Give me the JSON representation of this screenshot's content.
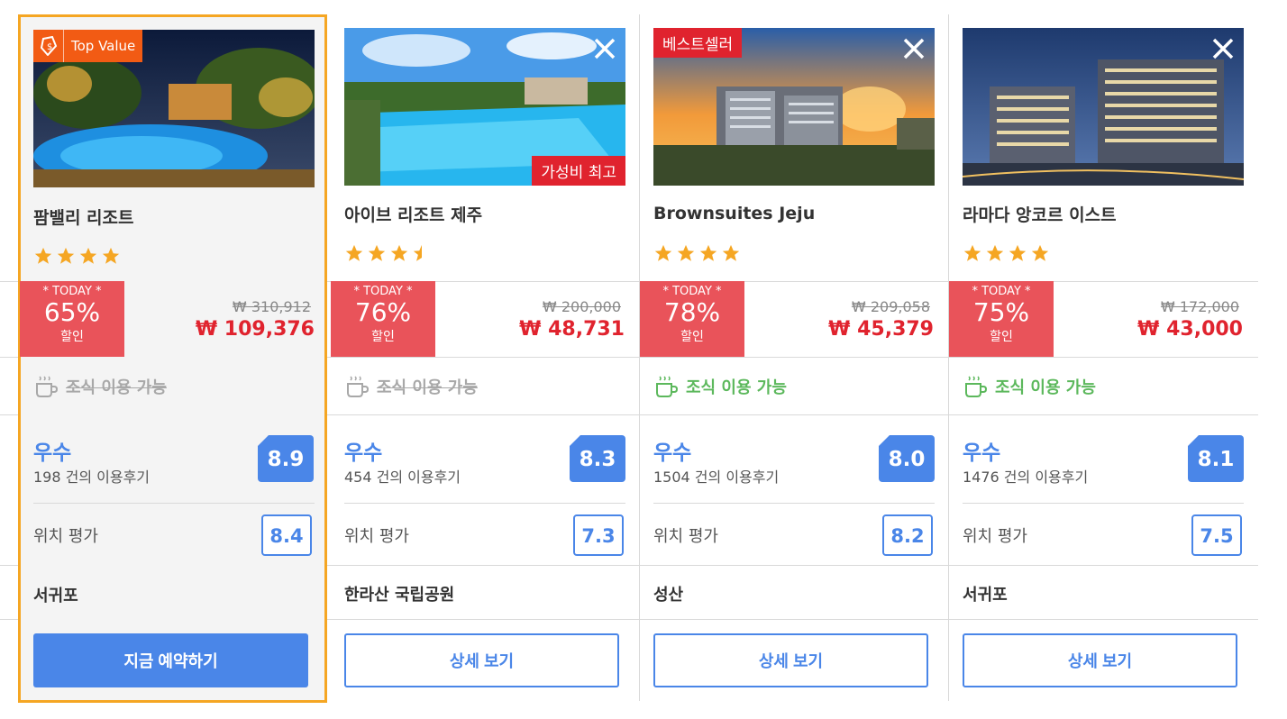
{
  "hotels": [
    {
      "name": "팜밸리 리조트",
      "badge": "Top Value",
      "stars": 4,
      "today_label": "* TODAY *",
      "discount": "65%",
      "discount_unit": "할인",
      "original_price": "₩ 310,912",
      "price": "₩ 109,376",
      "breakfast": "조식 이용 가능",
      "breakfast_available": false,
      "grade": "우수",
      "reviews": "198 건의 이용후기",
      "score": "8.9",
      "location_label": "위치 평가",
      "location_score": "8.4",
      "area": "서귀포",
      "button": "지금 예약하기"
    },
    {
      "name": "아이브 리조트 제주",
      "badge": "가성비 최고",
      "stars": 3.5,
      "today_label": "* TODAY *",
      "discount": "76%",
      "discount_unit": "할인",
      "original_price": "₩ 200,000",
      "price": "₩ 48,731",
      "breakfast": "조식 이용 가능",
      "breakfast_available": false,
      "grade": "우수",
      "reviews": "454 건의 이용후기",
      "score": "8.3",
      "location_label": "위치 평가",
      "location_score": "7.3",
      "area": "한라산 국립공원",
      "button": "상세 보기"
    },
    {
      "name": "Brownsuites Jeju",
      "badge": "베스트셀러",
      "stars": 4,
      "today_label": "* TODAY *",
      "discount": "78%",
      "discount_unit": "할인",
      "original_price": "₩ 209,058",
      "price": "₩ 45,379",
      "breakfast": "조식 이용 가능",
      "breakfast_available": true,
      "grade": "우수",
      "reviews": "1504 건의 이용후기",
      "score": "8.0",
      "location_label": "위치 평가",
      "location_score": "8.2",
      "area": "성산",
      "button": "상세 보기"
    },
    {
      "name": "라마다 앙코르 이스트",
      "stars": 4,
      "today_label": "* TODAY *",
      "discount": "75%",
      "discount_unit": "할인",
      "original_price": "₩ 172,000",
      "price": "₩ 43,000",
      "breakfast": "조식 이용 가능",
      "breakfast_available": true,
      "grade": "우수",
      "reviews": "1476 건의 이용후기",
      "score": "8.1",
      "location_label": "위치 평가",
      "location_score": "7.5",
      "area": "서귀포",
      "button": "상세 보기"
    }
  ],
  "colors": {
    "accent_blue": "#4a86e8",
    "discount_red": "#e9535a",
    "price_red": "#e0232e",
    "featured_border": "#f5a623",
    "top_value_orange": "#f25b14",
    "breakfast_green": "#5cb85c"
  },
  "icons": {
    "close": "close-icon",
    "star": "star-icon",
    "half_star": "star-half-icon",
    "coffee": "coffee-cup-icon",
    "tag": "price-tag-icon"
  }
}
